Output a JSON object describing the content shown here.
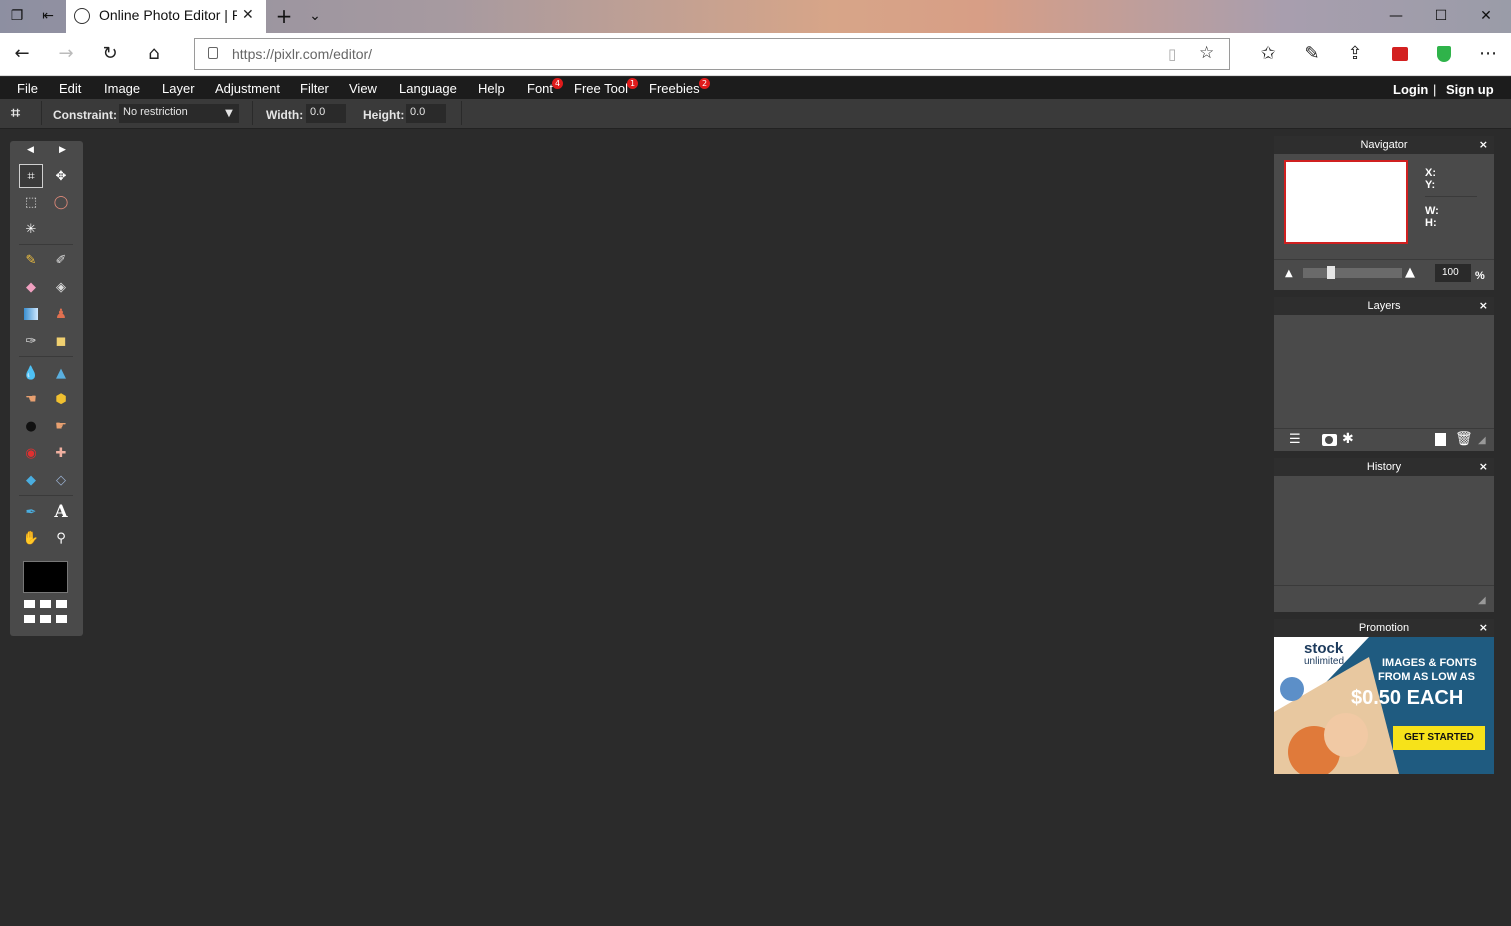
{
  "browser": {
    "tab_title": "Online Photo Editor | Pixlr Editor",
    "url": "https://pixlr.com/editor/",
    "new_tab": "+",
    "tab_menu": "⌄"
  },
  "menu": {
    "items": [
      "File",
      "Edit",
      "Image",
      "Layer",
      "Adjustment",
      "Filter",
      "View",
      "Language",
      "Help",
      "Font",
      "Free Tool",
      "Freebies"
    ],
    "badges": {
      "font": "4",
      "free_tool": "1",
      "freebies": "2"
    },
    "login": "Login",
    "separator": "|",
    "signup": "Sign up"
  },
  "options": {
    "constraint_label": "Constraint:",
    "constraint_value": "No restriction",
    "width_label": "Width:",
    "width_value": "0.0",
    "height_label": "Height:",
    "height_value": "0.0"
  },
  "panels": {
    "navigator": {
      "title": "Navigator",
      "x": "X:",
      "y": "Y:",
      "w": "W:",
      "h": "H:",
      "zoom": "100",
      "percent": "%"
    },
    "layers": {
      "title": "Layers"
    },
    "history": {
      "title": "History"
    },
    "promotion": {
      "title": "Promotion",
      "brand1": "stock",
      "brand2": "unlimited",
      "line1": "IMAGES & FONTS",
      "line2": "FROM AS LOW AS",
      "price": "$0.50 EACH",
      "cta": "GET STARTED"
    },
    "close": "×"
  },
  "colors": {
    "accent_badge": "#e01b1b",
    "canvas_bg": "#2b2b2b",
    "foreground_color": "#000000",
    "cta_bg": "#f6e21a",
    "promo_bg": "#1f5b80"
  }
}
